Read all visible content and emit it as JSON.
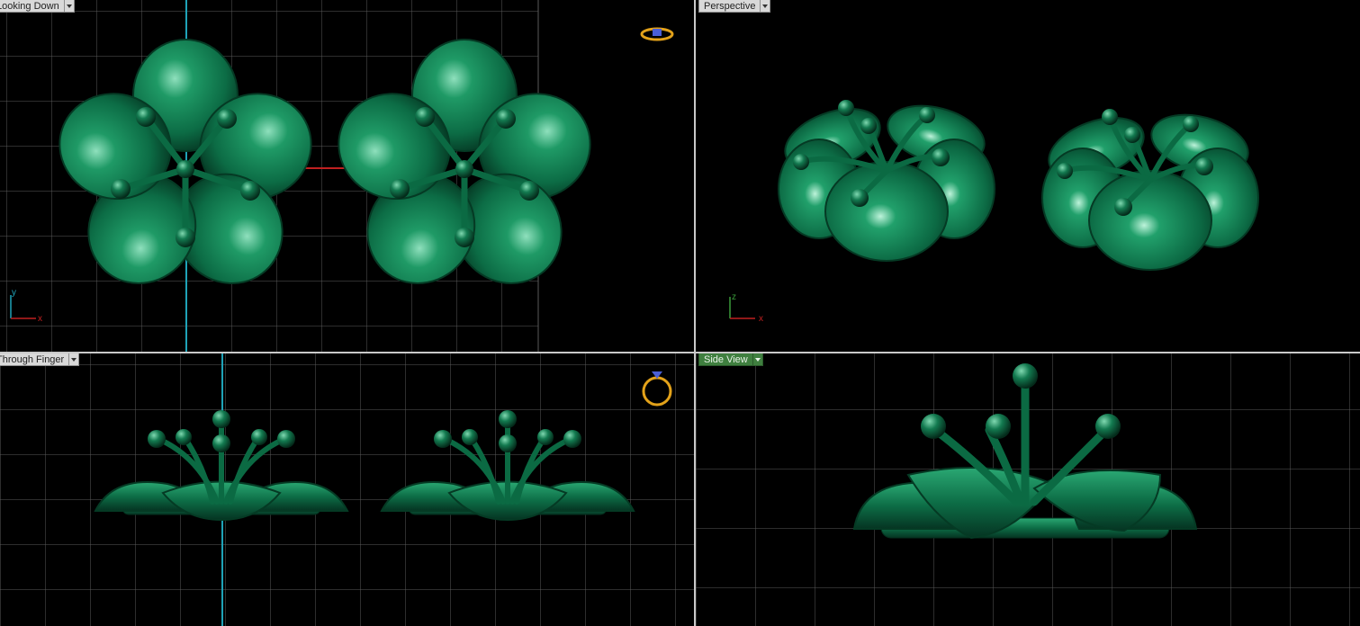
{
  "viewports": {
    "top_left": {
      "label": "Looking Down",
      "axis_x": "x",
      "axis_y": "y"
    },
    "top_right": {
      "label": "Perspective",
      "axis_x": "x",
      "axis_y": "z"
    },
    "bottom_left": {
      "label": "Through Finger"
    },
    "bottom_right": {
      "label": "Side View",
      "active": true
    }
  },
  "colors": {
    "background": "#000000",
    "grid": "#5a5a5a",
    "model": "#0f7a50",
    "model_dark": "#063d27",
    "model_highlight": "#8fe0bd",
    "axis_y_line": "#1fa3b8",
    "axis_x_line": "#c02020",
    "label_bg": "#d9d9d9",
    "active_label_bg": "#3f7f3f",
    "ring_icon": "#e3a21a"
  },
  "icons": {
    "view_ring_top": "ring-top-view-icon",
    "view_ring_side": "ring-side-view-icon"
  }
}
